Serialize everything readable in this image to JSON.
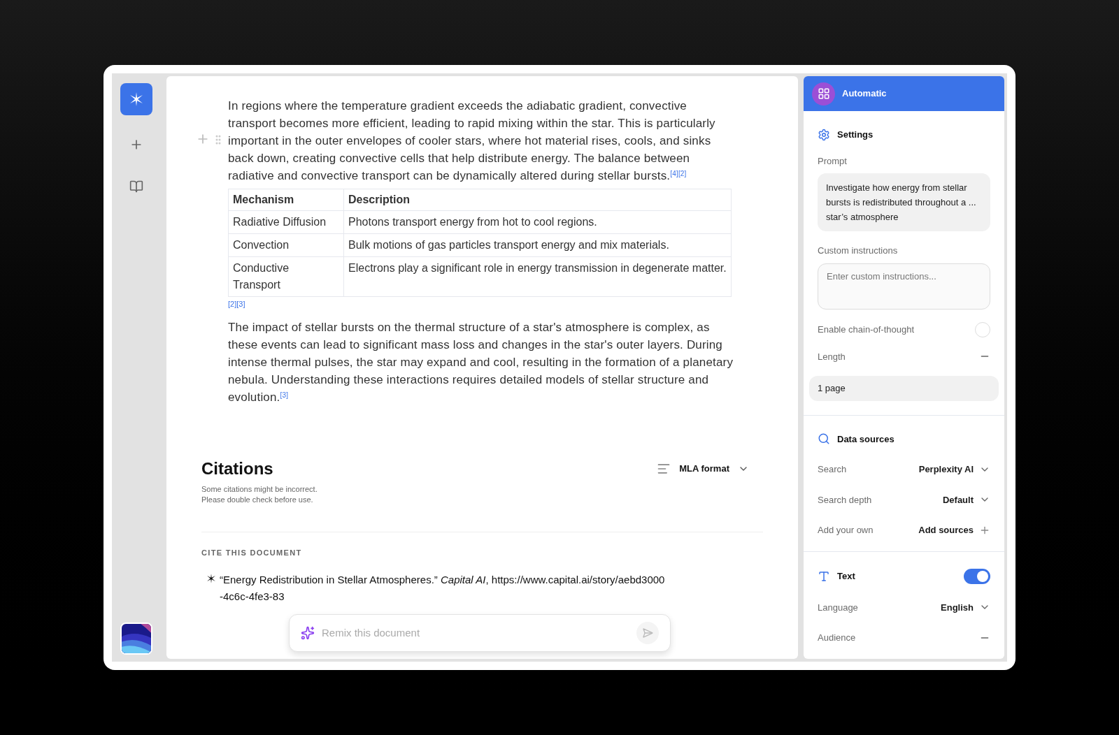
{
  "document": {
    "paragraphs_top": [
      "In regions where the temperature gradient exceeds the adiabatic gradient, convective transport becomes more efficient, leading to rapid mixing within the star. This is particularly important in the outer envelopes of cooler stars, where hot material rises, cools, and sinks back down, creating convective cells that help distribute energy. The balance between radiative and convective transport can be dynamically altered during stellar bursts.$^{[4][2]}$"
    ],
    "table": {
      "columns": [
        "Mechanism",
        "Description"
      ],
      "rows": [
        [
          "Radiative Diffusion",
          "Photons transport energy from hot to cool regions."
        ],
        [
          "Convection",
          "Bulk motions of gas particles transport energy and mix materials."
        ],
        [
          "Conductive Transport",
          "Electrons play a significant role in energy transmission in degenerate matter."
        ]
      ],
      "refs": "[2][3]"
    },
    "paragraphs_bottom": [
      "The impact of stellar bursts on the thermal structure of a star's atmosphere is complex, as these events can lead to significant mass loss and changes in the star's outer layers. During intense thermal pulses, the star may expand and cool, resulting in the formation of a planetary nebula. Understanding these interactions requires detailed models of stellar structure and evolution.$^{[3]}$"
    ]
  },
  "citations": {
    "title": "Citations",
    "notes": [
      "Some citations might be incorrect.",
      "Please double check before use."
    ],
    "format": "MLA format",
    "section_label": "CITE THIS DOCUMENT",
    "entry_lines": [
      "“Energy Redistribution in Stellar Atmospheres.” *Capital AI*, https://www.capital.ai/story/aebd3000",
      "-4c6c-4fe3-83"
    ]
  },
  "remix": {
    "placeholder": "Remix this document"
  },
  "panel": {
    "header": "Automatic",
    "sections": [
      {
        "kind": "settings",
        "title": "Settings",
        "items": [
          {
            "kind": "textblock",
            "label": "Prompt",
            "value": "Investigate how energy from stellar bursts is redistributed throughout a ... star’s atmosphere"
          },
          {
            "kind": "textarea",
            "label": "Custom instructions",
            "placeholder": "Enter custom instructions..."
          },
          {
            "kind": "checkbox",
            "label": "Enable chain-of-thought",
            "on": false
          },
          {
            "kind": "minus",
            "label": "Length"
          },
          {
            "kind": "option",
            "value": "1 page"
          }
        ]
      },
      {
        "kind": "sources",
        "title": "Data sources",
        "items": [
          {
            "kind": "select",
            "label": "Search",
            "value": "Perplexity AI"
          },
          {
            "kind": "select",
            "label": "Search depth",
            "value": "Default"
          },
          {
            "kind": "add",
            "label": "Add your own",
            "value": "Add sources"
          }
        ]
      },
      {
        "kind": "text",
        "title": "Text",
        "on": true,
        "items": [
          {
            "kind": "select",
            "label": "Language",
            "value": "English"
          },
          {
            "kind": "minus",
            "label": "Audience"
          }
        ]
      }
    ]
  }
}
